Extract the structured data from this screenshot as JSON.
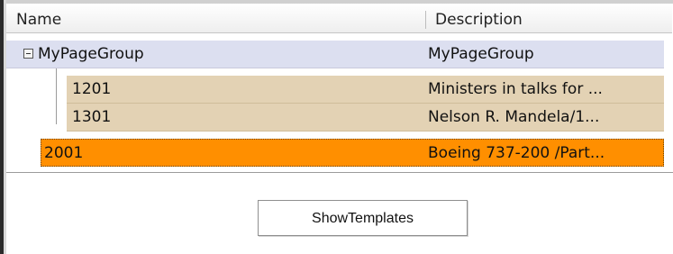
{
  "header": {
    "name_label": "Name",
    "description_label": "Description"
  },
  "tree": {
    "group": {
      "name": "MyPageGroup",
      "description": "MyPageGroup",
      "expanded": true
    },
    "children": [
      {
        "name": "1201",
        "description": "Ministers in talks for ..."
      },
      {
        "name": "1301",
        "description": "Nelson R. Mandela/1..."
      }
    ],
    "selected": {
      "name": "2001",
      "description": "Boeing 737-200 /Part..."
    }
  },
  "button": {
    "label": "ShowTemplates"
  },
  "colors": {
    "group_row_bg": "#dcdff0",
    "child_row_bg": "#e3d2b4",
    "selected_row_bg": "#ff8f00"
  }
}
